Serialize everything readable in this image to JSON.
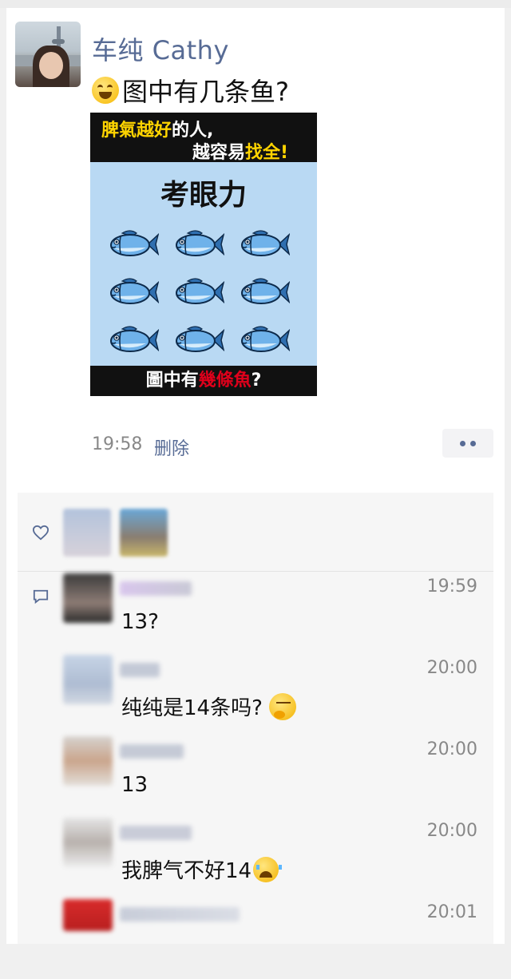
{
  "post": {
    "username": "车纯 Cathy",
    "text": "图中有几条鱼?",
    "emoji": "laughing-emoji",
    "time": "19:58",
    "delete_label": "删除"
  },
  "image": {
    "line1_white_a": "",
    "line1_yellow": "脾氣越好",
    "line1_white": "的人,",
    "line2_white": "越容易",
    "line2_yellow": "找全!",
    "title": "考眼力",
    "bottom_white_a": "圖中有",
    "bottom_red": "幾條魚",
    "bottom_white_b": "?",
    "fish_count_drawn": 9
  },
  "comments": [
    {
      "time": "19:59",
      "text": "13?",
      "emoji": ""
    },
    {
      "time": "20:00",
      "text": "纯纯是14条吗?",
      "emoji": "thinking-emoji"
    },
    {
      "time": "20:00",
      "text": "13",
      "emoji": ""
    },
    {
      "time": "20:00",
      "text": "我脾气不好14",
      "emoji": "crying-emoji"
    },
    {
      "time": "20:01",
      "text": "",
      "emoji": ""
    }
  ],
  "colors": {
    "link": "#576b95",
    "background": "#f0f0f0",
    "comment_area": "#f6f6f6",
    "image_bg": "#b9d9f3"
  },
  "icons": [
    "heart-icon",
    "comment-bubble-icon",
    "more-dots-icon"
  ]
}
